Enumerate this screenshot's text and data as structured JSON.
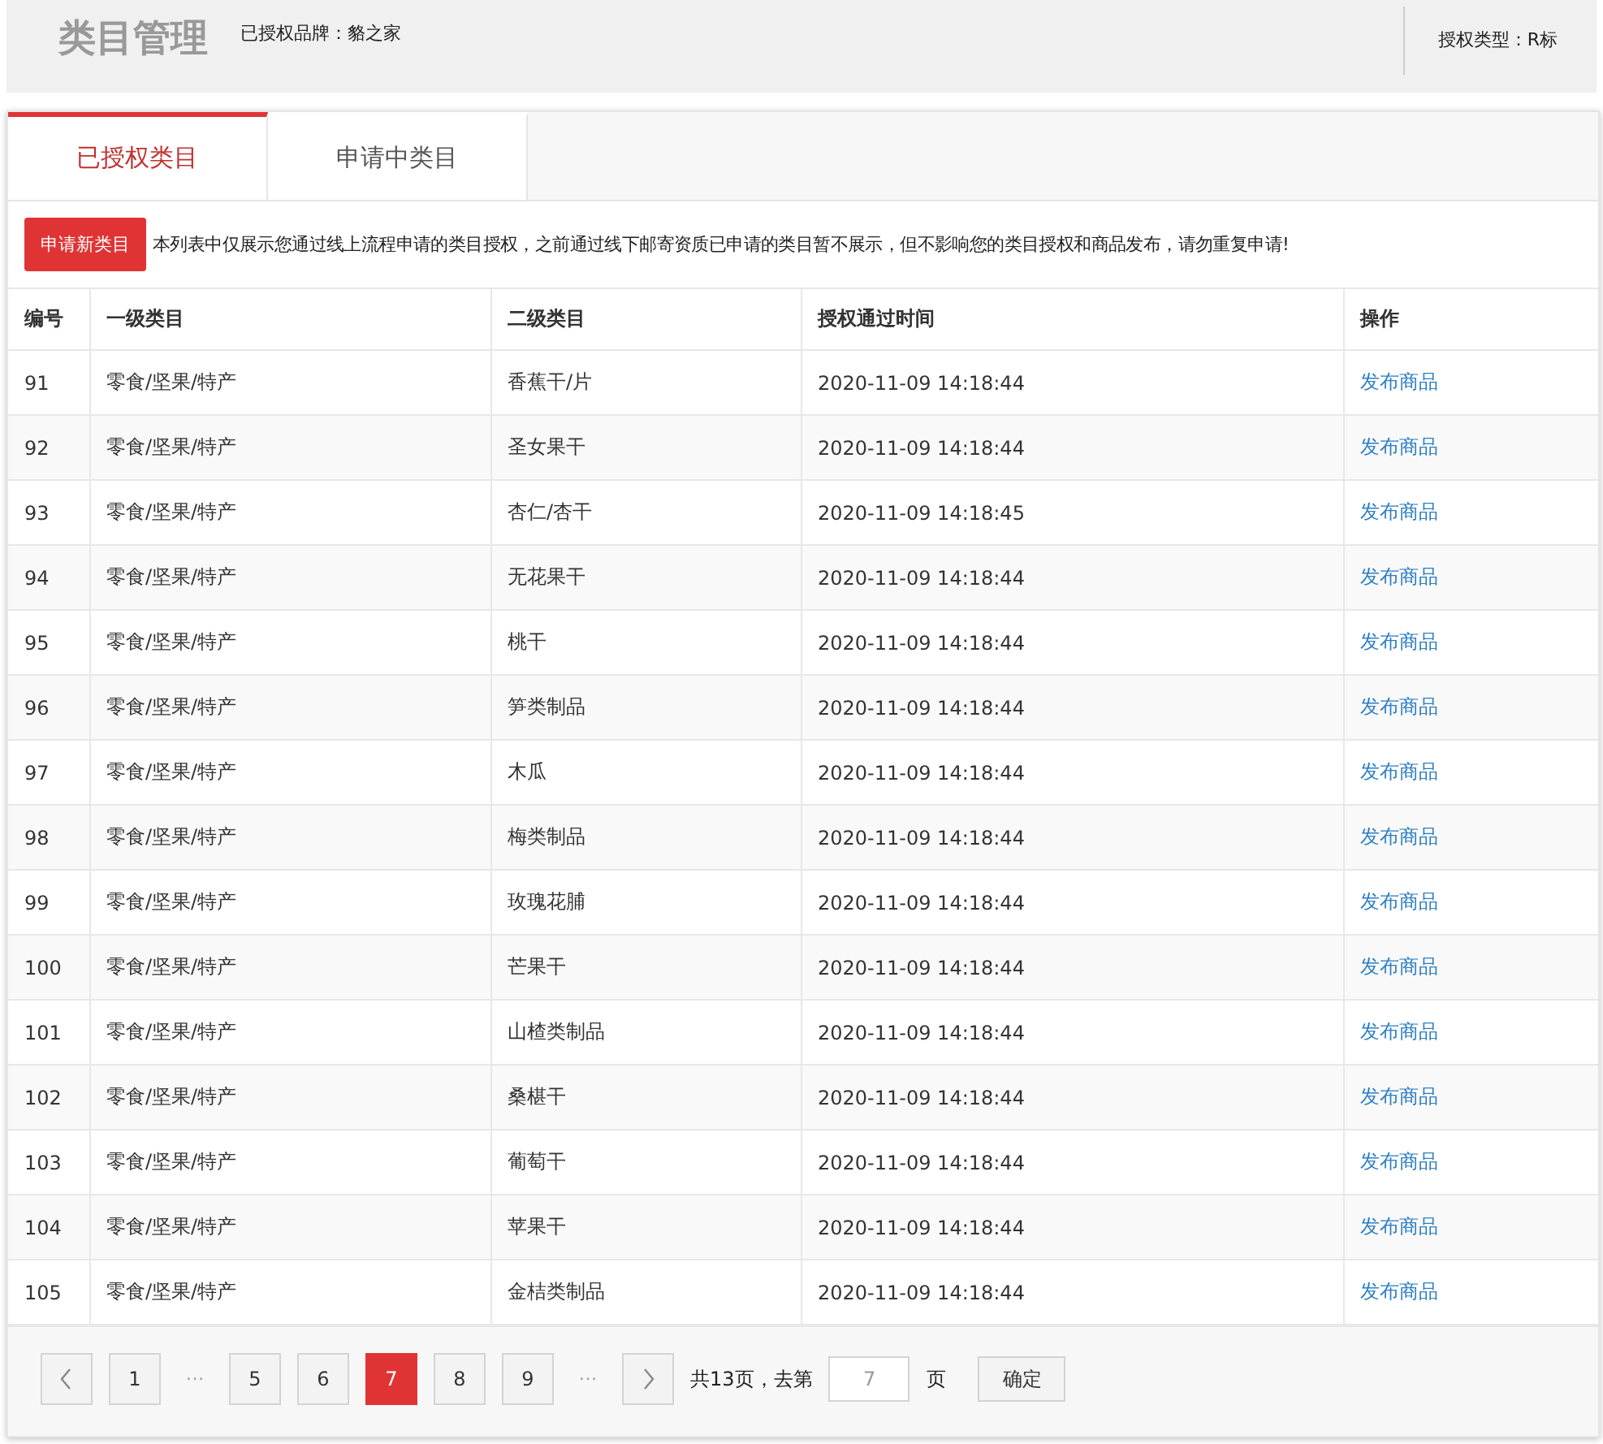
{
  "header": {
    "title": "类目管理",
    "brand": "已授权品牌：貉之家",
    "auth_type": "授权类型：R标"
  },
  "tabs": [
    {
      "label": "已授权类目",
      "selected": true
    },
    {
      "label": "申请中类目",
      "selected": false
    }
  ],
  "apply_button": "申请新类目",
  "notice": "本列表中仅展示您通过线上流程申请的类目授权，之前通过线下邮寄资质已申请的类目暂不展示，但不影响您的类目授权和商品发布，请勿重复申请!",
  "table": {
    "columns": [
      "编号",
      "一级类目",
      "二级类目",
      "授权通过时间",
      "操作"
    ],
    "rows": [
      {
        "id": "91",
        "level1": "零食/坚果/特产",
        "level2": "香蕉干/片",
        "time": "2020-11-09 14:18:44",
        "action": "发布商品"
      },
      {
        "id": "92",
        "level1": "零食/坚果/特产",
        "level2": "圣女果干",
        "time": "2020-11-09 14:18:44",
        "action": "发布商品"
      },
      {
        "id": "93",
        "level1": "零食/坚果/特产",
        "level2": "杏仁/杏干",
        "time": "2020-11-09 14:18:45",
        "action": "发布商品"
      },
      {
        "id": "94",
        "level1": "零食/坚果/特产",
        "level2": "无花果干",
        "time": "2020-11-09 14:18:44",
        "action": "发布商品"
      },
      {
        "id": "95",
        "level1": "零食/坚果/特产",
        "level2": "桃干",
        "time": "2020-11-09 14:18:44",
        "action": "发布商品"
      },
      {
        "id": "96",
        "level1": "零食/坚果/特产",
        "level2": "笋类制品",
        "time": "2020-11-09 14:18:44",
        "action": "发布商品"
      },
      {
        "id": "97",
        "level1": "零食/坚果/特产",
        "level2": "木瓜",
        "time": "2020-11-09 14:18:44",
        "action": "发布商品"
      },
      {
        "id": "98",
        "level1": "零食/坚果/特产",
        "level2": "梅类制品",
        "time": "2020-11-09 14:18:44",
        "action": "发布商品"
      },
      {
        "id": "99",
        "level1": "零食/坚果/特产",
        "level2": "玫瑰花脯",
        "time": "2020-11-09 14:18:44",
        "action": "发布商品"
      },
      {
        "id": "100",
        "level1": "零食/坚果/特产",
        "level2": "芒果干",
        "time": "2020-11-09 14:18:44",
        "action": "发布商品"
      },
      {
        "id": "101",
        "level1": "零食/坚果/特产",
        "level2": "山楂类制品",
        "time": "2020-11-09 14:18:44",
        "action": "发布商品"
      },
      {
        "id": "102",
        "level1": "零食/坚果/特产",
        "level2": "桑椹干",
        "time": "2020-11-09 14:18:44",
        "action": "发布商品"
      },
      {
        "id": "103",
        "level1": "零食/坚果/特产",
        "level2": "葡萄干",
        "time": "2020-11-09 14:18:44",
        "action": "发布商品"
      },
      {
        "id": "104",
        "level1": "零食/坚果/特产",
        "level2": "苹果干",
        "time": "2020-11-09 14:18:44",
        "action": "发布商品"
      },
      {
        "id": "105",
        "level1": "零食/坚果/特产",
        "level2": "金桔类制品",
        "time": "2020-11-09 14:18:44",
        "action": "发布商品"
      }
    ]
  },
  "pagination": {
    "items": [
      {
        "kind": "prev"
      },
      {
        "kind": "page",
        "label": "1",
        "selected": false
      },
      {
        "kind": "ellipsis",
        "label": "···"
      },
      {
        "kind": "page",
        "label": "5",
        "selected": false
      },
      {
        "kind": "page",
        "label": "6",
        "selected": false
      },
      {
        "kind": "page",
        "label": "7",
        "selected": true
      },
      {
        "kind": "page",
        "label": "8",
        "selected": false
      },
      {
        "kind": "page",
        "label": "9",
        "selected": false
      },
      {
        "kind": "ellipsis",
        "label": "···"
      },
      {
        "kind": "next"
      }
    ],
    "total_text": "共13页，去第",
    "goto_value": "7",
    "page_suffix": "页",
    "confirm_button": "确定"
  }
}
